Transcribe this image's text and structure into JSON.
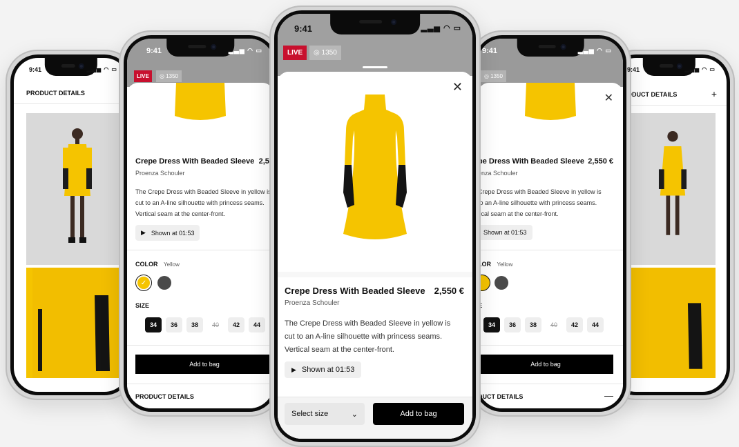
{
  "status_time": "9:41",
  "status_icons": "▂▃▅ ◠ ▭",
  "live": {
    "badge": "LIVE",
    "viewers": "1350",
    "eye_icon": "eye-icon"
  },
  "product": {
    "name": "Crepe Dress With Beaded Sleeve",
    "price": "2,550 €",
    "brand": "Proenza Schouler",
    "description": "The Crepe Dress with Beaded Sleeve in yellow is cut to an A-line silhouette with princess seams. Vertical seam at the center-front.",
    "shown_label": "Shown at 01:53",
    "color_label": "COLOR",
    "color_value": "Yellow",
    "size_label": "SIZE",
    "sizes": [
      "34",
      "36",
      "38",
      "40",
      "42",
      "44"
    ],
    "selected_size": "34",
    "unavailable_size": "40",
    "add_to_bag": "Add to bag",
    "select_size": "Select size",
    "product_details": "PRODUCT DETAILS",
    "product_details_trunc": "DUCT DETAILS",
    "product_details_far_left": "PRODUCT DETAILS",
    "product_details_far_right": "ODUCT DETAILS"
  },
  "truncated": {
    "name_right": "pe Dress With Beaded Sleeve",
    "brand_right": "enza Schouler",
    "desc_right_1": "Crepe Dress with Beaded Sleeve in yellow is",
    "desc_right_2": "to an A-line silhouette with princess seams.",
    "desc_right_3": "tical seam at the center-front.",
    "color_right": "LOR",
    "size_right": "E",
    "price_left": "2,55",
    "desc_left_1": "The Crepe Dress with Beaded Sleeve in yellow is",
    "desc_left_2": "cut to an A-line silhouette with princess seams.",
    "desc_left_3": "Vertical seam at the center-front.",
    "product_details_right": "ODUCT DETAILS",
    "product_details_right2": "DUCT DETAILS"
  },
  "colors": {
    "accent_yellow": "#f5c400",
    "live_red": "#c8102e",
    "dark_swatch": "#4a4a4a"
  }
}
